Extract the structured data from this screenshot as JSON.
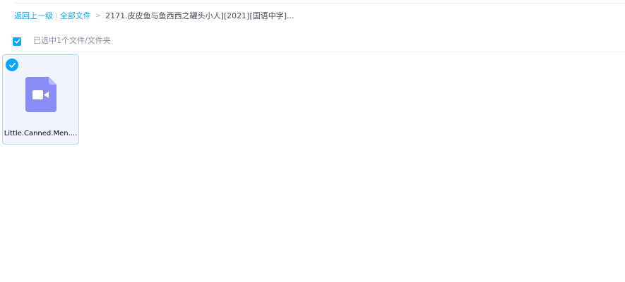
{
  "breadcrumb": {
    "back_label": "返回上一级",
    "separator": "|",
    "all_files_label": "全部文件",
    "arrow": ">",
    "current_folder": "2171.皮皮鱼与鱼西西之罐头小人][2021][国语中字]..."
  },
  "selection": {
    "text": "已选中1个文件/文件夹",
    "checked": true
  },
  "files": [
    {
      "name": "Little.Canned.Men....",
      "type_icon": "video-file-icon",
      "selected": true
    }
  ],
  "colors": {
    "accent": "#06a7ff",
    "video_icon": "#8a8cf5",
    "card_selected_bg": "#f0f5fd",
    "card_selected_border": "#a5dcff"
  }
}
